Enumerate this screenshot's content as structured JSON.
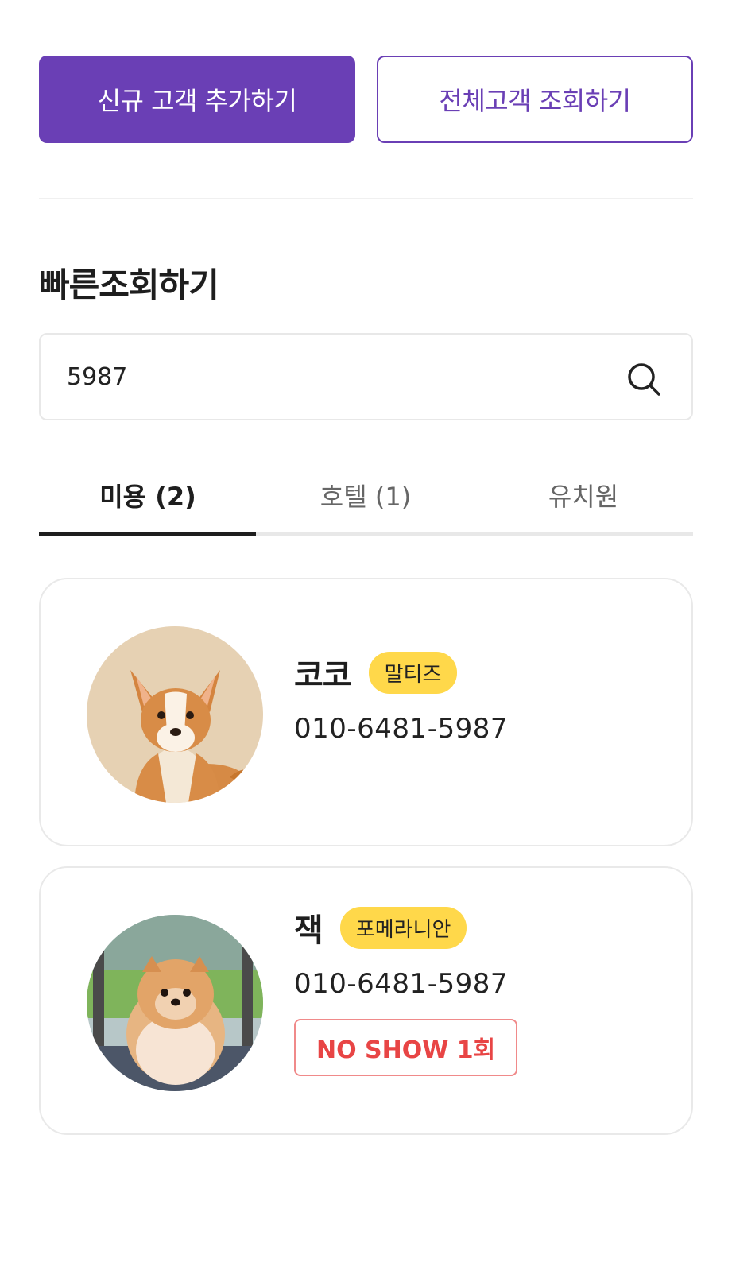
{
  "actions": {
    "add_customer": "신규 고객 추가하기",
    "view_all_customers": "전체고객 조회하기"
  },
  "quick_search": {
    "title": "빠른조회하기",
    "value": "5987",
    "icon": "search-icon"
  },
  "tabs": [
    {
      "label": "미용 (2)",
      "active": true
    },
    {
      "label": "호텔 (1)",
      "active": false
    },
    {
      "label": "유치원",
      "active": false
    }
  ],
  "results": [
    {
      "name": "코코",
      "breed": "말티즈",
      "phone": "010-6481-5987"
    },
    {
      "name": "잭",
      "breed": "포메라니안",
      "phone": "010-6481-5987",
      "noshow": "NO SHOW 1회"
    }
  ],
  "colors": {
    "primary": "#6a3fb5",
    "badge": "#ffd84a",
    "noshow": "#e84545"
  }
}
